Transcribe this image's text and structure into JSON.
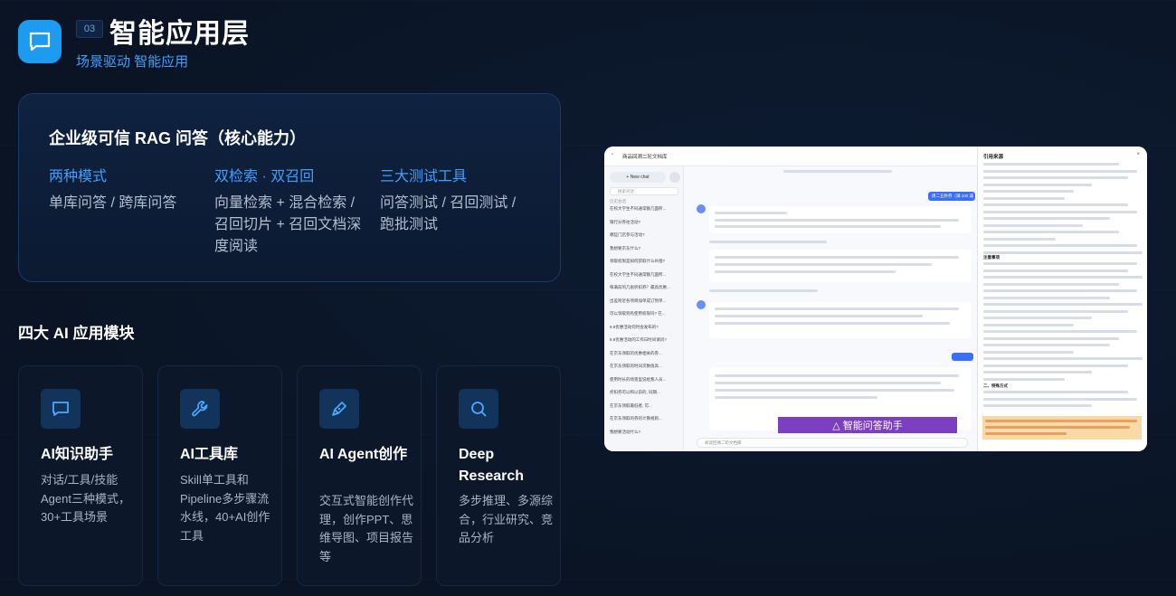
{
  "header": {
    "number": "03",
    "title": "智能应用层",
    "subtitle": "场景驱动 智能应用"
  },
  "rag": {
    "title": "企业级可信 RAG 问答（核心能力）",
    "columns": [
      {
        "title": "两种模式",
        "desc": "单库问答 / 跨库问答"
      },
      {
        "title": "双检索 · 双召回",
        "desc": "向量检索 + 混合检索 / 召回切片 + 召回文档深度阅读"
      },
      {
        "title": "三大测试工具",
        "desc": "问答测试 / 召回测试 / 跑批测试"
      }
    ]
  },
  "modules_title": "四大 AI 应用模块",
  "modules": [
    {
      "icon": "chat-icon",
      "title": "AI知识助手",
      "desc": "对话/工具/技能Agent三种模式，30+工具场景"
    },
    {
      "icon": "wrench-icon",
      "title": "AI工具库",
      "desc": "Skill单工具和Pipeline多步骤流水线，40+AI创作工具"
    },
    {
      "icon": "pen-icon",
      "title": "AI Agent创作",
      "desc": "交互式智能创作代理，创作PPT、思维导图、项目报告等"
    },
    {
      "icon": "search-icon",
      "title": "Deep Research",
      "desc": "多步推理、多源综合，行业研究、竞品分析"
    }
  ],
  "screenshot": {
    "window_title": "商品回溯二轮文档库",
    "new_chat": "+ New chat",
    "search_placeholder": "搜索对话",
    "side_header": "历史会话",
    "side_items": [
      "在校大学生不同通常额几面所...",
      "银行分券往活动?",
      "哪些门店参与活动?",
      "我想要京东什么?",
      "领取权限是如何获取什么补偿?",
      "在校大学生不同通常额几面所...",
      "每满前的几张折扣券？最高优惠...",
      "出差附近各项目加单成订到单...",
      "可以领取到有使用权限吗? 在...",
      "8.8优惠活动何时会发布的?",
      "8.8优惠活动的工作日时间请问?",
      "在京东领取的优惠相关的券...",
      "在京东领取的时间次数值高...",
      "使用时长的场景里说给我人员...",
      "折扣券可以和以前的, 同期...",
      "在京东领取最低者, 可...",
      "在京东领取的券的计算规则...",
      "我想要活动什么?"
    ],
    "user_bubble": "周二五秒券（满 100 减",
    "bottom_input": "阅读回溯二轮文档库",
    "panel_title": "引用来源",
    "panel_section": "注意事项",
    "panel_section2": "二、特殊方式",
    "banner": "△ 智能问答助手"
  }
}
